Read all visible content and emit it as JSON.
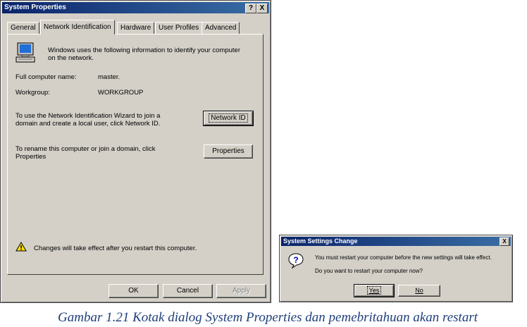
{
  "main_dialog": {
    "title": "System Properties",
    "help_btn": "?",
    "close_btn": "X",
    "tabs": [
      "General",
      "Network Identification",
      "Hardware",
      "User Profiles",
      "Advanced"
    ],
    "info_line1": "Windows uses the following information to identify your computer",
    "info_line2": "on the network.",
    "full_name_label": "Full computer name:",
    "full_name_value": "master.",
    "workgroup_label": "Workgroup:",
    "workgroup_value": "WORKGROUP",
    "wizard_text1": "To use the Network Identification Wizard to join a",
    "wizard_text2": "domain and create a local user, click Network ID.",
    "network_id_btn": "Network ID",
    "rename_text1": "To rename this computer or join a domain, click",
    "rename_text2": "Properties",
    "properties_btn": "Properties",
    "warning_text": "Changes will take effect after you restart this computer.",
    "ok_btn": "OK",
    "cancel_btn": "Cancel",
    "apply_btn": "Apply"
  },
  "restart_dialog": {
    "title": "System Settings Change",
    "close_btn": "X",
    "message1": "You must restart your computer before the new settings will take effect.",
    "message2": "Do you want to restart your computer now?",
    "yes_btn": "Yes",
    "no_btn": "No"
  },
  "caption": "Gambar 1.21 Kotak dialog System Properties dan pemebritahuan akan restart"
}
